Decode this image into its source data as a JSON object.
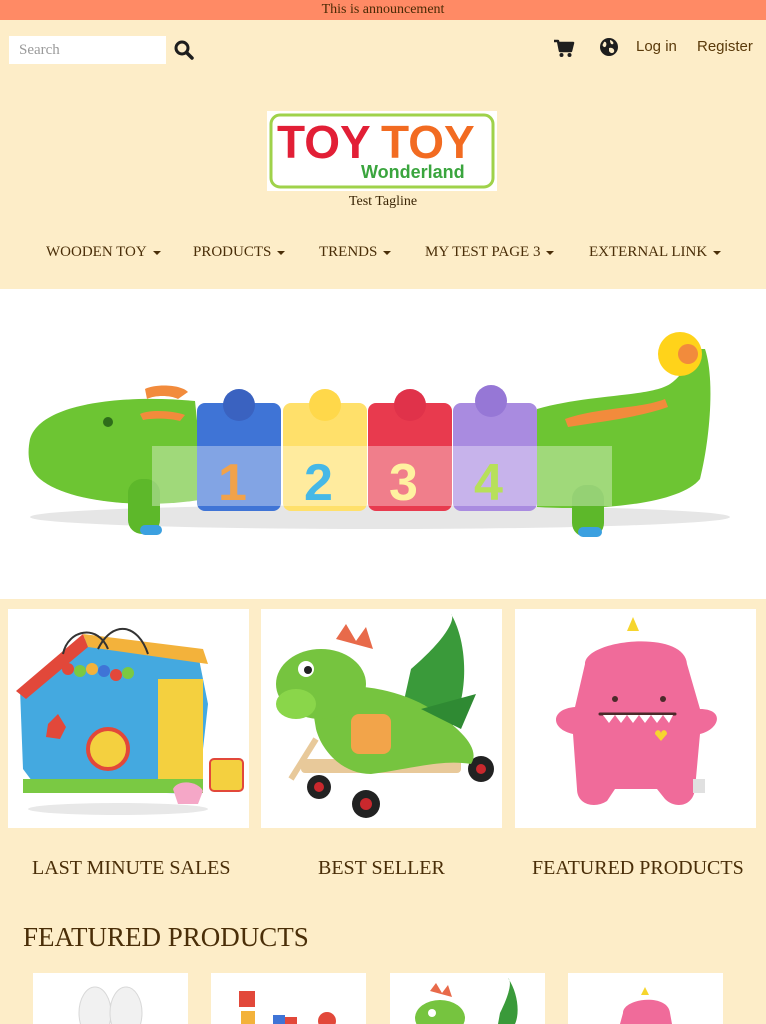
{
  "announcement": "This is announcement",
  "header": {
    "search_placeholder": "Search",
    "login_label": "Log in",
    "register_label": "Register",
    "search_icon": "search-icon",
    "cart_icon": "cart-icon",
    "language_icon": "globe-icon"
  },
  "brand": {
    "logo_toy1": "TOY",
    "logo_toy2": "TOY",
    "logo_sub": "Wonderland",
    "tagline": "Test Tagline"
  },
  "nav": [
    {
      "label": "WOODEN TOY"
    },
    {
      "label": "PRODUCTS"
    },
    {
      "label": "TRENDS"
    },
    {
      "label": "MY TEST PAGE 3"
    },
    {
      "label": "EXTERNAL LINK"
    }
  ],
  "hero": {
    "numbers": [
      "1",
      "2",
      "3",
      "4"
    ]
  },
  "categories": [
    {
      "title": "LAST MINUTE SALES"
    },
    {
      "title": "BEST SELLER"
    },
    {
      "title": "FEATURED PRODUCTS"
    }
  ],
  "featured": {
    "title": "FEATURED PRODUCTS"
  },
  "colors": {
    "announcement_bg": "#ff8a65",
    "page_bg": "#fdedc8",
    "text": "#4a2e08"
  }
}
